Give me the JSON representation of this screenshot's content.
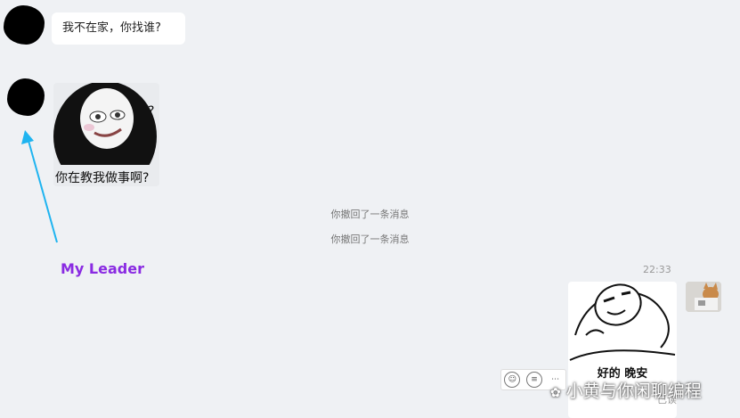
{
  "messages": {
    "incoming_text": "我不在家，你找谁?",
    "incoming_sticker_caption": "你在教我做事啊?",
    "incoming_sticker_mark": "?",
    "recall_notices": [
      "你撤回了一条消息",
      "你撤回了一条消息"
    ],
    "timestamp": "22:33",
    "outgoing_sticker_caption": "好的 晚安",
    "read_status": "已读"
  },
  "annotation": {
    "label": "My Leader",
    "color": "#8a2be2",
    "arrow_color": "#1fb4f0"
  },
  "watermark": {
    "text": "小黄与你闲聊编程"
  },
  "action_bar": {
    "icons": [
      "emoji-icon",
      "comment-icon",
      "more-icon"
    ]
  },
  "colors": {
    "background": "#eff1f4",
    "bubble": "#ffffff"
  }
}
